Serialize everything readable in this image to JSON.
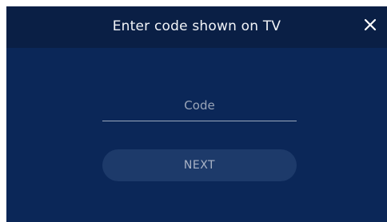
{
  "dialog": {
    "title": "Enter code shown on TV",
    "close_icon": "close-icon",
    "code_input": {
      "placeholder": "Code",
      "value": ""
    },
    "next_button_label": "NEXT"
  },
  "colors": {
    "header_background": "#0a1f45",
    "body_background": "#0b2758",
    "button_background": "#1d3a6a",
    "title_text": "#f2f4f8",
    "muted_text": "#9aa5b8"
  }
}
